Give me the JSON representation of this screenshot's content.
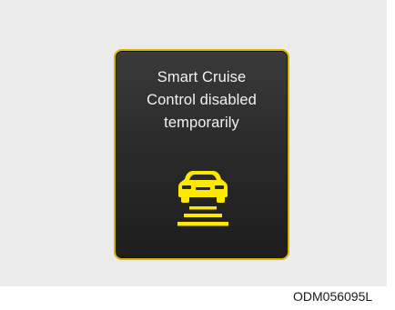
{
  "display": {
    "message_lines": [
      "Smart Cruise",
      "Control disabled",
      "temporarily"
    ],
    "icon": "smart-cruise-control-car-icon",
    "colors": {
      "border": "#d6b300",
      "icon": "#ffe800",
      "text": "#f2f2f2",
      "background": "#2b2b2b"
    }
  },
  "figure_code": "ODM056095L"
}
